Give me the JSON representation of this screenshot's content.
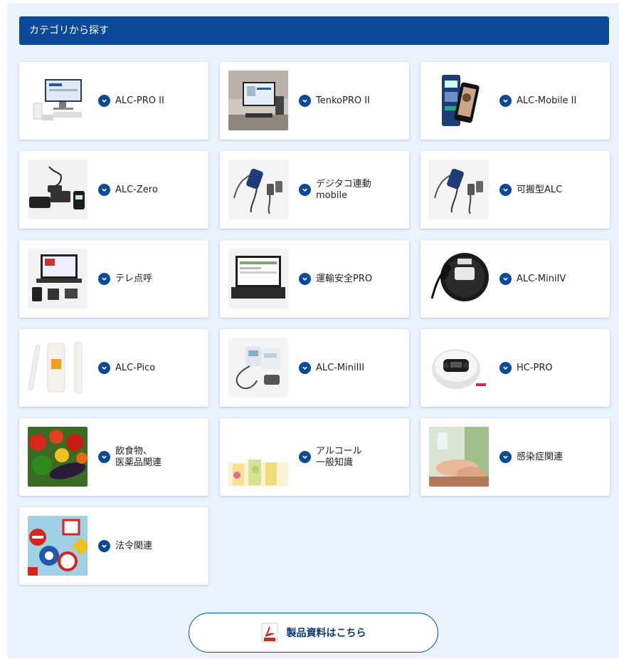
{
  "section": {
    "title": "カテゴリから探す"
  },
  "categories": [
    {
      "label": "ALC-PRO II",
      "thumb": "pc-monitor-with-breathalyzer"
    },
    {
      "label": "TenkoPRO II",
      "thumb": "office-monitor-desk"
    },
    {
      "label": "ALC-Mobile II",
      "thumb": "device-and-smartphone"
    },
    {
      "label": "ALC-Zero",
      "thumb": "black-breathalyzer-units"
    },
    {
      "label": "デジタコ連動\nmobile",
      "thumb": "handheld-sensors-with-cables"
    },
    {
      "label": "可搬型ALC",
      "thumb": "handheld-sensors-with-cables"
    },
    {
      "label": "テレ点呼",
      "thumb": "laptop-with-devices"
    },
    {
      "label": "運輸安全PRO",
      "thumb": "laptop-software"
    },
    {
      "label": "ALC-MiniIV",
      "thumb": "round-breathalyzer-with-wand"
    },
    {
      "label": "ALC-Pico",
      "thumb": "white-pen-breathalyzer"
    },
    {
      "label": "ALC-MiniIII",
      "thumb": "white-breathalyzer-printer"
    },
    {
      "label": "HC-PRO",
      "thumb": "round-health-checker"
    },
    {
      "label": "飲食物、\n医薬品関連",
      "thumb": "vegetables-photo"
    },
    {
      "label": "アルコール\n一般知識",
      "thumb": "drinks-photo"
    },
    {
      "label": "感染症関連",
      "thumb": "hand-sanitizer-photo"
    },
    {
      "label": "法令関連",
      "thumb": "traffic-signs-photo"
    }
  ],
  "documents_button": {
    "label": "製品資料はこちら",
    "icon": "pdf-icon"
  },
  "colors": {
    "accent": "#0a4a99",
    "background": "#e9f2fd"
  }
}
